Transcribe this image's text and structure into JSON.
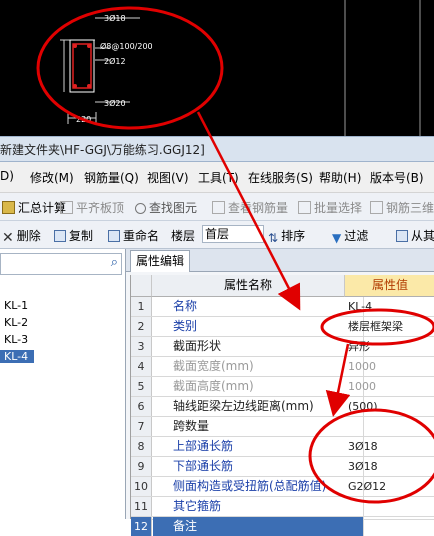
{
  "cad": {
    "dim_top": "3Ø18",
    "dim_mid1": "Ø8@100/200",
    "dim_mid2": "2Ø12",
    "dim_bottom": "3Ø20",
    "dim_width": "220"
  },
  "title_bar": {
    "text": "新建文件夹\\HF-GGJ\\万能练习.GGJ12]"
  },
  "menu": {
    "items": [
      "D)",
      "修改(M)",
      "钢筋量(Q)",
      "视图(V)",
      "工具(T)",
      "在线服务(S)",
      "帮助(H)",
      "版本号(B)"
    ]
  },
  "toolbar1": {
    "items": [
      "汇总计算",
      "平齐板顶",
      "查找图元",
      "查看钢筋量",
      "批量选择",
      "钢筋三维"
    ]
  },
  "toolbar2": {
    "delete": "删除",
    "copy": "复制",
    "rename": "重命名",
    "floor_label": "楼层",
    "floor_value": "首层",
    "sort": "排序",
    "filter": "过滤",
    "from": "从其"
  },
  "left_panel": {
    "items": [
      "KL-1",
      "KL-2",
      "KL-3",
      "KL-4"
    ],
    "selected_index": 3
  },
  "right_panel": {
    "tab": "属性编辑",
    "header_name": "属性名称",
    "header_value": "属性值",
    "rows": [
      {
        "num": "1",
        "name": "名称",
        "value": "KL-4"
      },
      {
        "num": "2",
        "name": "类别",
        "value": "楼层框架梁"
      },
      {
        "num": "3",
        "name": "截面形状",
        "value": "异形"
      },
      {
        "num": "4",
        "name": "截面宽度(mm)",
        "value": "1000"
      },
      {
        "num": "5",
        "name": "截面高度(mm)",
        "value": "1000"
      },
      {
        "num": "6",
        "name": "轴线距梁左边线距离(mm)",
        "value": "(500)"
      },
      {
        "num": "7",
        "name": "跨数量",
        "value": ""
      },
      {
        "num": "8",
        "name": "上部通长筋",
        "value": "3Ø18"
      },
      {
        "num": "9",
        "name": "下部通长筋",
        "value": "3Ø18"
      },
      {
        "num": "10",
        "name": "侧面构造或受扭筋(总配筋值)",
        "value": "G2Ø12"
      },
      {
        "num": "11",
        "name": "其它箍筋",
        "value": ""
      },
      {
        "num": "12",
        "name": "备注",
        "value": ""
      }
    ]
  },
  "colors": {
    "annotation_red": "#e00000",
    "selected_blue": "#3c6eb4",
    "header_value_bg": "#fbe9a8"
  }
}
